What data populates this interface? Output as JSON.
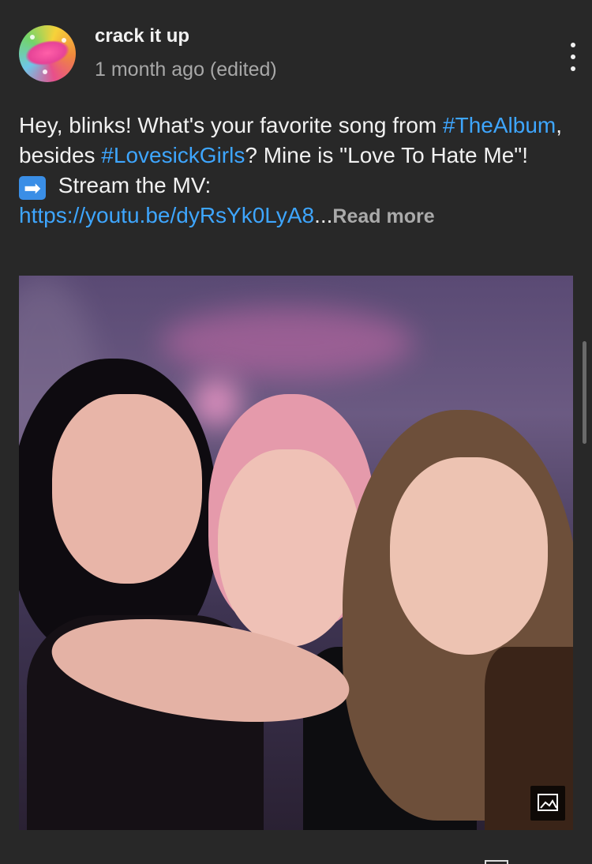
{
  "post": {
    "channel_name": "crack it up",
    "timestamp": "1 month ago (edited)",
    "text": {
      "part1": "Hey, blinks! What's your favorite song from ",
      "hashtag1": "#TheAlbum",
      "part2": ", besides ",
      "hashtag2": "#LovesickGirls",
      "part3": "? Mine is \"Love To Hate Me\"!",
      "arrow_emoji": "➡",
      "part4": " Stream the MV: ",
      "link": "https://youtu.be/dyRsYk0LyA8",
      "ellipsis": "...",
      "read_more": "Read more"
    },
    "icons": {
      "more": "more-vert-icon",
      "image_badge": "image-icon",
      "avatar": "channel-avatar"
    },
    "colors": {
      "background": "#282828",
      "link": "#3ea6ff",
      "secondary_text": "#aaaaaa"
    }
  }
}
